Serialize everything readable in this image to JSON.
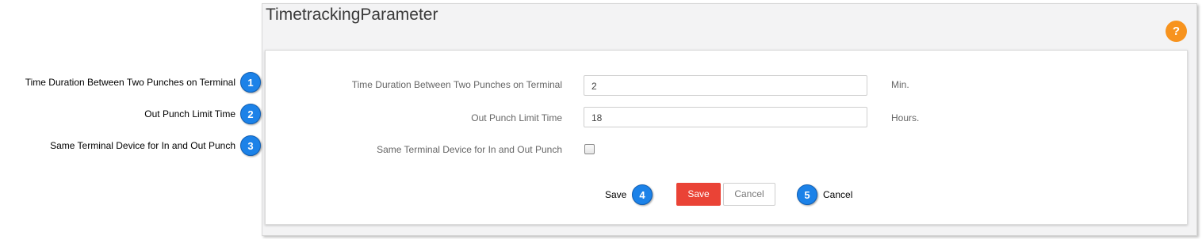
{
  "page": {
    "title": "TimetrackingParameter",
    "help_glyph": "?"
  },
  "form": {
    "fields": [
      {
        "label": "Time Duration Between Two Punches on Terminal",
        "value": "2",
        "unit": "Min."
      },
      {
        "label": "Out Punch Limit Time",
        "value": "18",
        "unit": "Hours."
      },
      {
        "label": "Same Terminal Device for In and Out Punch",
        "checked": false
      }
    ],
    "save_label": "Save",
    "cancel_label": "Cancel"
  },
  "callouts": [
    {
      "number": "1",
      "text": "Time Duration Between Two Punches on Terminal"
    },
    {
      "number": "2",
      "text": "Out Punch Limit Time"
    },
    {
      "number": "3",
      "text": "Same Terminal Device for In and Out Punch"
    },
    {
      "number": "4",
      "text": "Save"
    },
    {
      "number": "5",
      "text": "Cancel"
    }
  ],
  "colors": {
    "save_button": "#ea4336",
    "callout_badge": "#1c82e8",
    "help_badge": "#f7931e"
  }
}
